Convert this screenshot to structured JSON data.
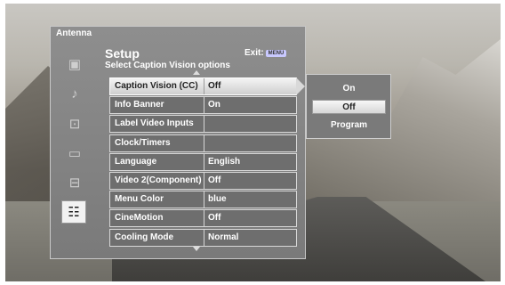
{
  "panel": {
    "title": "Antenna"
  },
  "header": {
    "title": "Setup",
    "subtitle": "Select Caption Vision options",
    "exit_label": "Exit:",
    "exit_badge": "MENU"
  },
  "sidebar": {
    "items": [
      {
        "icon": "picture-icon",
        "glyph": "▣"
      },
      {
        "icon": "music-note-icon",
        "glyph": "♪"
      },
      {
        "icon": "widescreen-icon",
        "glyph": "⊡"
      },
      {
        "icon": "tv-input-icon",
        "glyph": "▭"
      },
      {
        "icon": "lock-icon",
        "glyph": "⊟"
      },
      {
        "icon": "setup-list-icon",
        "glyph": "☷",
        "selected": true
      }
    ]
  },
  "menu": {
    "rows": [
      {
        "label": "Caption Vision (CC)",
        "value": "Off",
        "active": true
      },
      {
        "label": "Info Banner",
        "value": "On"
      },
      {
        "label": "Label Video Inputs",
        "value": ""
      },
      {
        "label": "Clock/Timers",
        "value": ""
      },
      {
        "label": "Language",
        "value": "English"
      },
      {
        "label": "Video 2(Component)",
        "value": "Off"
      },
      {
        "label": "Menu Color",
        "value": "blue"
      },
      {
        "label": "CineMotion",
        "value": "Off"
      },
      {
        "label": "Cooling Mode",
        "value": "Normal"
      }
    ]
  },
  "popup": {
    "options": [
      {
        "label": "On"
      },
      {
        "label": "Off",
        "selected": true
      },
      {
        "label": "Program"
      }
    ]
  }
}
